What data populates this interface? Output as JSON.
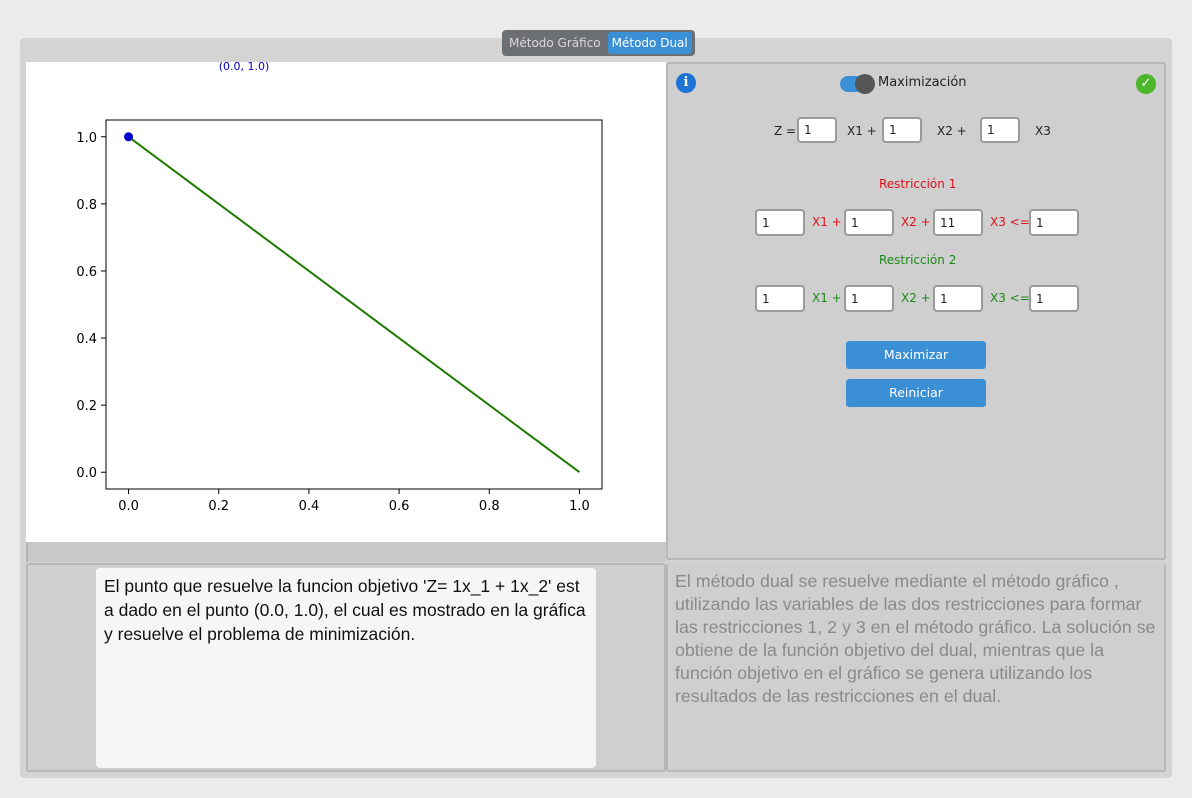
{
  "tabs": [
    {
      "label": "Método Gráfico",
      "active": false
    },
    {
      "label": "Método Dual",
      "active": true
    }
  ],
  "plot": {
    "point_label": "(0.0, 1.0)"
  },
  "chart_data": {
    "type": "line",
    "series": [
      {
        "values_x": [
          0.0,
          1.0
        ],
        "values_y": [
          1.0,
          0.0
        ],
        "color": "#1e7a00"
      }
    ],
    "points": [
      {
        "x": 0.0,
        "y": 1.0,
        "color": "#0000cc"
      }
    ],
    "xticks": [
      "0.0",
      "0.2",
      "0.4",
      "0.6",
      "0.8",
      "1.0"
    ],
    "yticks": [
      "0.0",
      "0.2",
      "0.4",
      "0.6",
      "0.8",
      "1.0"
    ],
    "xlim": [
      -0.05,
      1.05
    ],
    "ylim": [
      -0.05,
      1.05
    ],
    "annotation": "(0.0, 1.0)"
  },
  "form": {
    "mode_label": "Maximización",
    "mode_on": true,
    "z_label": "Z =",
    "z_coeffs": [
      "1",
      "1",
      "1"
    ],
    "var_labels": [
      "X1 +",
      "X2 +",
      "X3"
    ],
    "r1_title": "Restricción 1",
    "r1_coeffs": [
      "1",
      "1",
      "11"
    ],
    "r1_rhs": "1",
    "r1_labels": [
      "X1 +",
      "X2 +",
      "X3 <="
    ],
    "r2_title": "Restricción 2",
    "r2_coeffs": [
      "1",
      "1",
      "1"
    ],
    "r2_rhs": "1",
    "r2_labels": [
      "X1 +",
      "X2 +",
      "X3 <="
    ],
    "maximize_label": "Maximizar",
    "reset_label": "Reiniciar"
  },
  "colors": {
    "accent": "#3b8fd5",
    "restriction1": "#e0101a",
    "restriction2": "#1a8a1a",
    "line": "#1e7a00"
  },
  "result_text": "El punto que resuelve la funcion objetivo 'Z= 1x_1 + 1x_2' esta dado en el punto (0.0, 1.0), el cual es mostrado en la gráfica y resuelve el problema de minimización.",
  "explanation_text": "El método dual se resuelve mediante el método gráfico , utilizando las variables de las dos restricciones para formar las restricciones 1, 2 y 3 en el método gráfico. La solución se obtiene de la función objetivo del dual, mientras que la función objetivo en el gráfico se genera utilizando los resultados de las restricciones en el dual."
}
